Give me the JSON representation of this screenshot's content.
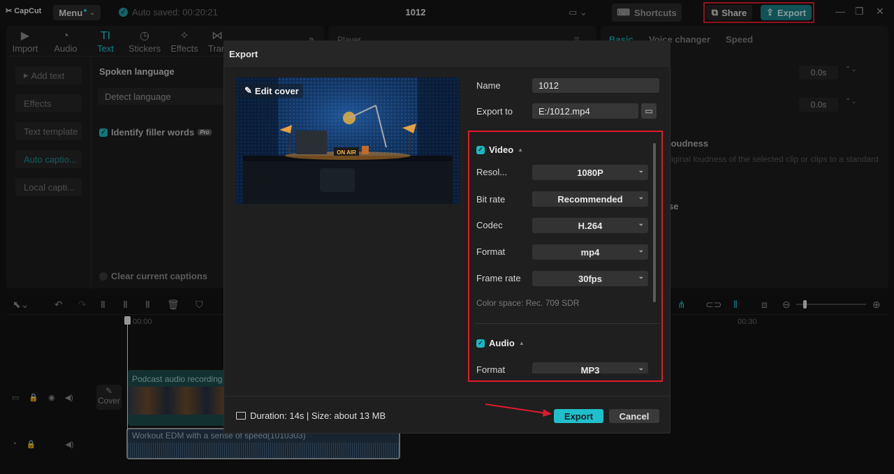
{
  "app": {
    "logo_text": "CapCut",
    "menu_label": "Menu",
    "autosave_text": "Auto saved: 00:20:21",
    "project_title": "1012"
  },
  "topbar": {
    "shortcuts_label": "Shortcuts",
    "share_label": "Share",
    "export_label": "Export"
  },
  "toolbar": {
    "items": [
      {
        "label": "Import",
        "icon": "import-icon"
      },
      {
        "label": "Audio",
        "icon": "audio-icon"
      },
      {
        "label": "Text",
        "icon": "text-icon"
      },
      {
        "label": "Stickers",
        "icon": "stickers-icon"
      },
      {
        "label": "Effects",
        "icon": "effects-icon"
      },
      {
        "label": "Tran",
        "icon": "transitions-icon"
      }
    ]
  },
  "sidebar": {
    "items": [
      "Add text",
      "Effects",
      "Text template",
      "Auto captio...",
      "Local capti..."
    ]
  },
  "captions": {
    "spoken_language_label": "Spoken language",
    "language_value": "Detect language",
    "filler_label": "Identify filler words",
    "pro_badge": "Pro",
    "clear_label": "Clear current captions"
  },
  "player": {
    "label": "Player"
  },
  "right_panel": {
    "tabs": [
      "Basic",
      "Voice changer",
      "Speed"
    ],
    "values": [
      "0.0s",
      "0.0s"
    ],
    "loudness_title": "loudness",
    "loudness_desc": "riginal loudness of the selected clip or clips to a standard",
    "noise_label": "se"
  },
  "timeline": {
    "time_start": "00:00",
    "time_mark": "00:30",
    "video_clip": "Podcast audio recording",
    "audio_clip": "Workout EDM with a sense of speed(1010303)",
    "cover_label": "Cover"
  },
  "export_dialog": {
    "title": "Export",
    "edit_cover": "Edit cover",
    "name_label": "Name",
    "name_value": "1012",
    "export_to_label": "Export to",
    "export_to_value": "E:/1012.mp4",
    "video_section": "Video",
    "video_fields": [
      {
        "label": "Resol...",
        "value": "1080P"
      },
      {
        "label": "Bit rate",
        "value": "Recommended"
      },
      {
        "label": "Codec",
        "value": "H.264"
      },
      {
        "label": "Format",
        "value": "mp4"
      },
      {
        "label": "Frame rate",
        "value": "30fps"
      }
    ],
    "color_space": "Color space: Rec. 709 SDR",
    "audio_section": "Audio",
    "audio_format_label": "Format",
    "audio_format_value": "MP3",
    "duration_text": "Duration: 14s | Size: about 13 MB",
    "export_button": "Export",
    "cancel_button": "Cancel",
    "cover_sign_text": "ON AIR"
  },
  "colors": {
    "accent": "#1fc0cb",
    "highlight": "#e3192b"
  }
}
